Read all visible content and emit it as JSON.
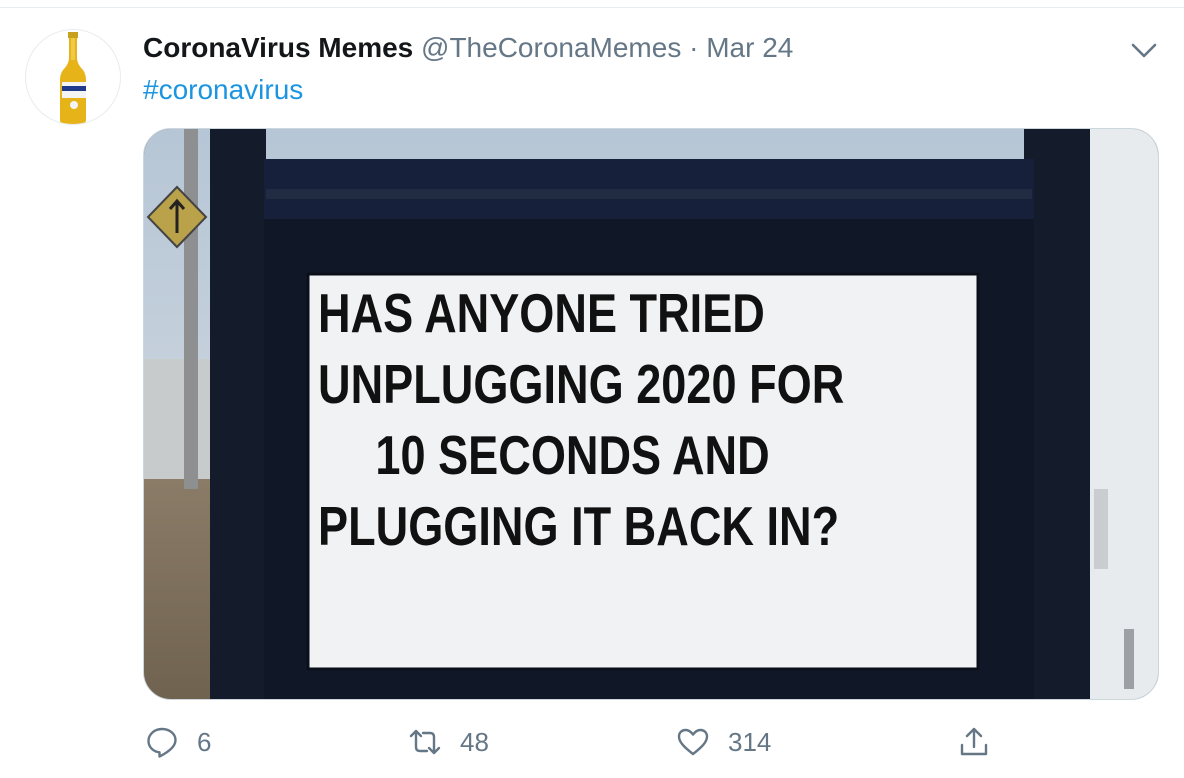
{
  "tweet": {
    "display_name": "CoronaVirus Memes",
    "handle": "@TheCoronaMemes",
    "separator": "·",
    "date": "Mar 24",
    "text": "#coronavirus",
    "avatar_icon": "beer-bottle-icon",
    "media": {
      "type": "photo",
      "sign_lines": [
        "HAS    ANYONE  TRIED",
        "UNPLUGGING 2020 FOR",
        "10  SECONDS  AND",
        "PLUGGING  IT  BACK  IN?"
      ]
    },
    "actions": {
      "reply_count": "6",
      "retweet_count": "48",
      "like_count": "314"
    }
  },
  "colors": {
    "link": "#1b95e0",
    "secondary_text": "#657786",
    "primary_text": "#14171a"
  }
}
